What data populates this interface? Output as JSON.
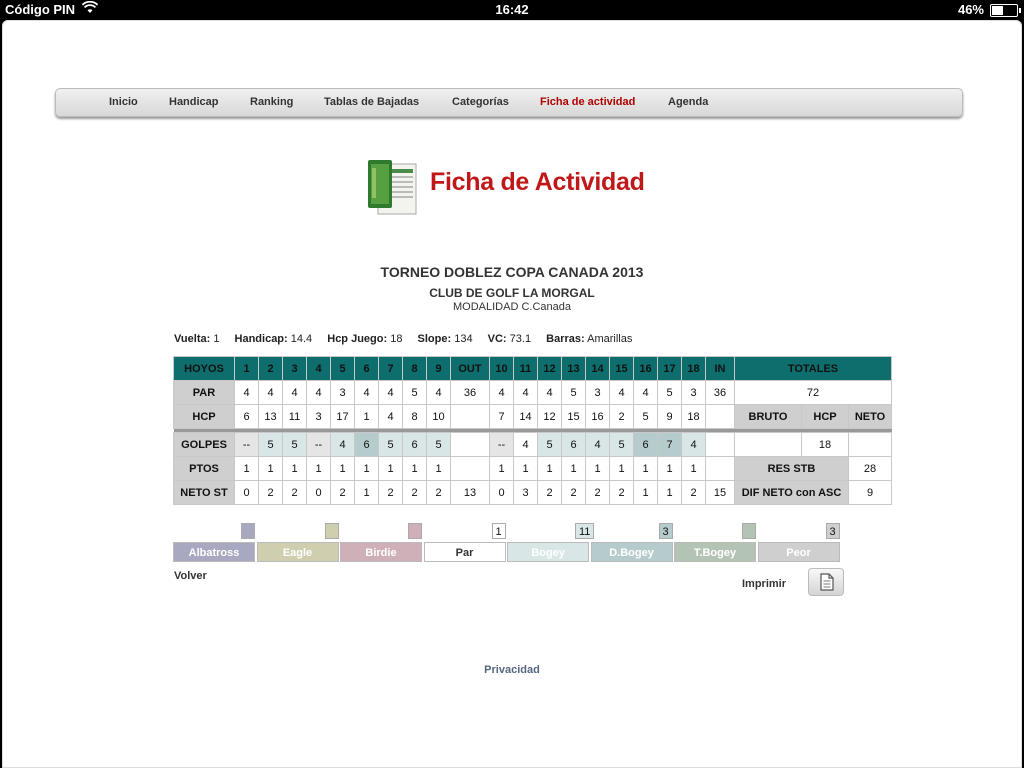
{
  "statusbar": {
    "carrier": "Código PIN",
    "time": "16:42",
    "battery": "46%"
  },
  "nav": {
    "items": [
      "Inicio",
      "Handicap",
      "Ranking",
      "Tablas de Bajadas",
      "Categorías",
      "Ficha de actividad",
      "Agenda"
    ],
    "active": "Ficha de actividad"
  },
  "hero": {
    "title": "Ficha de Actividad"
  },
  "tournament": {
    "title": "TORNEO DOBLEZ COPA CANADA 2013",
    "club": "CLUB DE GOLF LA MORGAL",
    "modalidad_label": "MODALIDAD",
    "modalidad_value": "C.Canada"
  },
  "info": {
    "vuelta_label": "Vuelta:",
    "vuelta": "1",
    "handicap_label": "Handicap:",
    "handicap": "14.4",
    "hcp_juego_label": "Hcp Juego:",
    "hcp_juego": "18",
    "slope_label": "Slope:",
    "slope": "134",
    "vc_label": "VC:",
    "vc": "73.1",
    "barras_label": "Barras:",
    "barras": "Amarillas"
  },
  "scorecard": {
    "hoyos_label": "HOYOS",
    "front": [
      "1",
      "2",
      "3",
      "4",
      "5",
      "6",
      "7",
      "8",
      "9"
    ],
    "out_label": "OUT",
    "back": [
      "10",
      "11",
      "12",
      "13",
      "14",
      "15",
      "16",
      "17",
      "18"
    ],
    "in_label": "IN",
    "totales_label": "TOTALES",
    "par_label": "PAR",
    "par_front": [
      "4",
      "4",
      "4",
      "4",
      "3",
      "4",
      "4",
      "5",
      "4"
    ],
    "par_out": "36",
    "par_back": [
      "4",
      "4",
      "4",
      "5",
      "3",
      "4",
      "4",
      "5",
      "3"
    ],
    "par_in": "36",
    "par_total": "72",
    "hcp_label": "HCP",
    "hcp_front": [
      "6",
      "13",
      "11",
      "3",
      "17",
      "1",
      "4",
      "8",
      "10"
    ],
    "hcp_back": [
      "7",
      "14",
      "12",
      "15",
      "16",
      "2",
      "5",
      "9",
      "18"
    ],
    "bruto_label": "BRUTO",
    "hcp_col_label": "HCP",
    "neto_label": "NETO",
    "golpes_label": "GOLPES",
    "golpes_front": [
      "--",
      "5",
      "5",
      "--",
      "4",
      "6",
      "5",
      "6",
      "5"
    ],
    "golpes_back": [
      "--",
      "4",
      "5",
      "6",
      "4",
      "5",
      "6",
      "7",
      "4"
    ],
    "golpes_hcp": "18",
    "ptos_label": "PTOS",
    "ptos_front": [
      "1",
      "1",
      "1",
      "1",
      "1",
      "1",
      "1",
      "1",
      "1"
    ],
    "ptos_back": [
      "1",
      "1",
      "1",
      "1",
      "1",
      "1",
      "1",
      "1",
      "1"
    ],
    "res_stb_label": "RES STB",
    "res_stb": "28",
    "neto_st_label": "NETO ST",
    "neto_front": [
      "0",
      "2",
      "2",
      "0",
      "2",
      "1",
      "2",
      "2",
      "2"
    ],
    "neto_out": "13",
    "neto_back": [
      "0",
      "3",
      "2",
      "2",
      "2",
      "2",
      "1",
      "1",
      "2"
    ],
    "neto_in": "15",
    "dif_label": "DIF NETO con ASC",
    "dif": "9"
  },
  "legend": [
    {
      "label": "Albatross",
      "count": "",
      "color": "#a8a8c0"
    },
    {
      "label": "Eagle",
      "count": "",
      "color": "#cfcfb0"
    },
    {
      "label": "Birdie",
      "count": "",
      "color": "#d0b0b8"
    },
    {
      "label": "Par",
      "count": "1",
      "color": "#ffffff"
    },
    {
      "label": "Bogey",
      "count": "11",
      "color": "#d9e6e6"
    },
    {
      "label": "D.Bogey",
      "count": "3",
      "color": "#b6cccc"
    },
    {
      "label": "T.Bogey",
      "count": "",
      "color": "#b4c4b4"
    },
    {
      "label": "Peor",
      "count": "3",
      "color": "#cfcfcf"
    }
  ],
  "actions": {
    "volver": "Volver",
    "imprimir": "Imprimir"
  },
  "footer": {
    "privacidad": "Privacidad"
  }
}
